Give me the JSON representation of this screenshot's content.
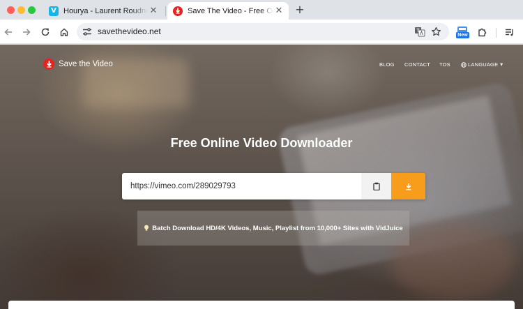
{
  "browser": {
    "tabs": [
      {
        "title": "Hourya - Laurent Roudneff & ",
        "favicon": "vimeo-icon",
        "favicon_letter": "V",
        "active": false
      },
      {
        "title": "Save The Video - Free Online ",
        "favicon": "savethevideo-icon",
        "active": true
      }
    ],
    "tab_close_glyph": "✕",
    "new_tab_glyph": "+",
    "address": "savethevideo.net",
    "extension_badge": "New",
    "icons": [
      "back-icon",
      "forward-icon",
      "reload-icon",
      "home-icon",
      "site-info-icon",
      "translate-icon",
      "star-icon",
      "puzzle-icon",
      "media-controls-icon"
    ]
  },
  "site": {
    "logo_text": "Save the Video",
    "nav": {
      "blog": "BLOG",
      "contact": "CONTACT",
      "tos": "TOS",
      "language": "LANGUAGE"
    },
    "hero_title": "Free Online Video Downloader",
    "url_input_value": "https://vimeo.com/289029793",
    "batch_banner": "Batch Download HD/4K Videos, Music, Playlist from 10,000+ Sites with VidJuice",
    "colors": {
      "brand_red": "#e5241f",
      "download_orange": "#f79c1b",
      "vimeo_blue": "#17b4e8"
    }
  }
}
